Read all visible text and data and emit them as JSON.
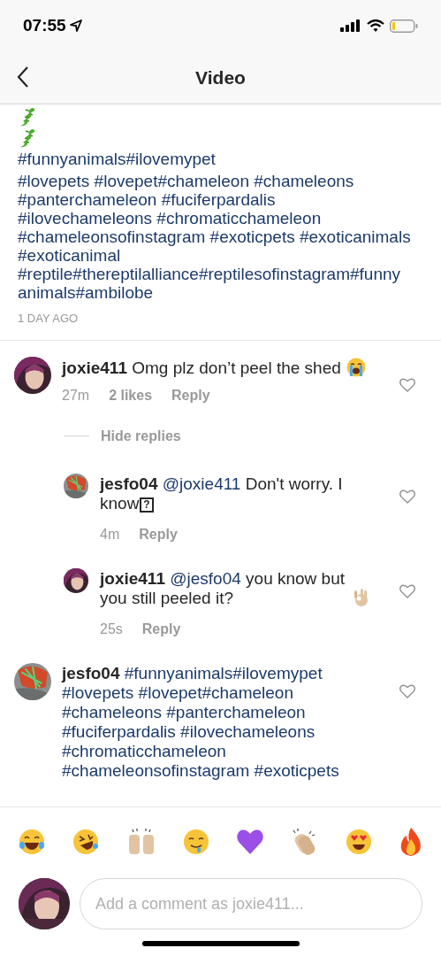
{
  "status_bar": {
    "time": "07:55"
  },
  "nav": {
    "title": "Video"
  },
  "caption": {
    "first_line": "#funnyanimals#ilovemypet",
    "body": "#lovepets #lovepet#chameleon #chameleons\n#panterchameleon #fuciferpardalis\n#ilovechameleons #chromaticchameleon\n#chameleonsofinstagram #exoticpets #exoticanimals\n#exoticanimal\n#reptile#thereptilalliance#reptilesofinstagram#funny\nanimals#ambilobe",
    "age": "1 DAY AGO"
  },
  "comments": [
    {
      "kind": "comment",
      "user": "joxie411",
      "text": "Omg plz don’t peel the shed",
      "emoji": {
        "kind": "crying-face"
      },
      "time": "27m",
      "likes": "2 likes",
      "reply": "Reply",
      "liked": false,
      "toggle": "Hide replies",
      "children": [
        {
          "kind": "reply",
          "user": "jesfo04",
          "mention": "@joxie411",
          "text": "Don't worry. I\nknow",
          "missing_glyph": "?",
          "time": "4m",
          "reply": "Reply",
          "liked": false
        },
        {
          "kind": "reply",
          "user": "joxie411",
          "mention": "@jesfo04",
          "text": "you know but\nyou still peeled it?",
          "emoji": {
            "kind": "ok-hand"
          },
          "time": "25s",
          "reply": "Reply",
          "liked": false
        }
      ]
    },
    {
      "kind": "comment",
      "user": "jesfo04",
      "mention": "#funnyanimals#ilovemypet",
      "text": "#lovepets #lovepet#chameleon\n#chameleons #panterchameleon\n#fuciferpardalis #ilovechameleons\n#chromaticchameleon\n#chameleonsofinstagram #exoticpets",
      "hashtags": true,
      "liked": false
    }
  ],
  "composer": {
    "placeholder": "Add a comment as joxie411..."
  }
}
